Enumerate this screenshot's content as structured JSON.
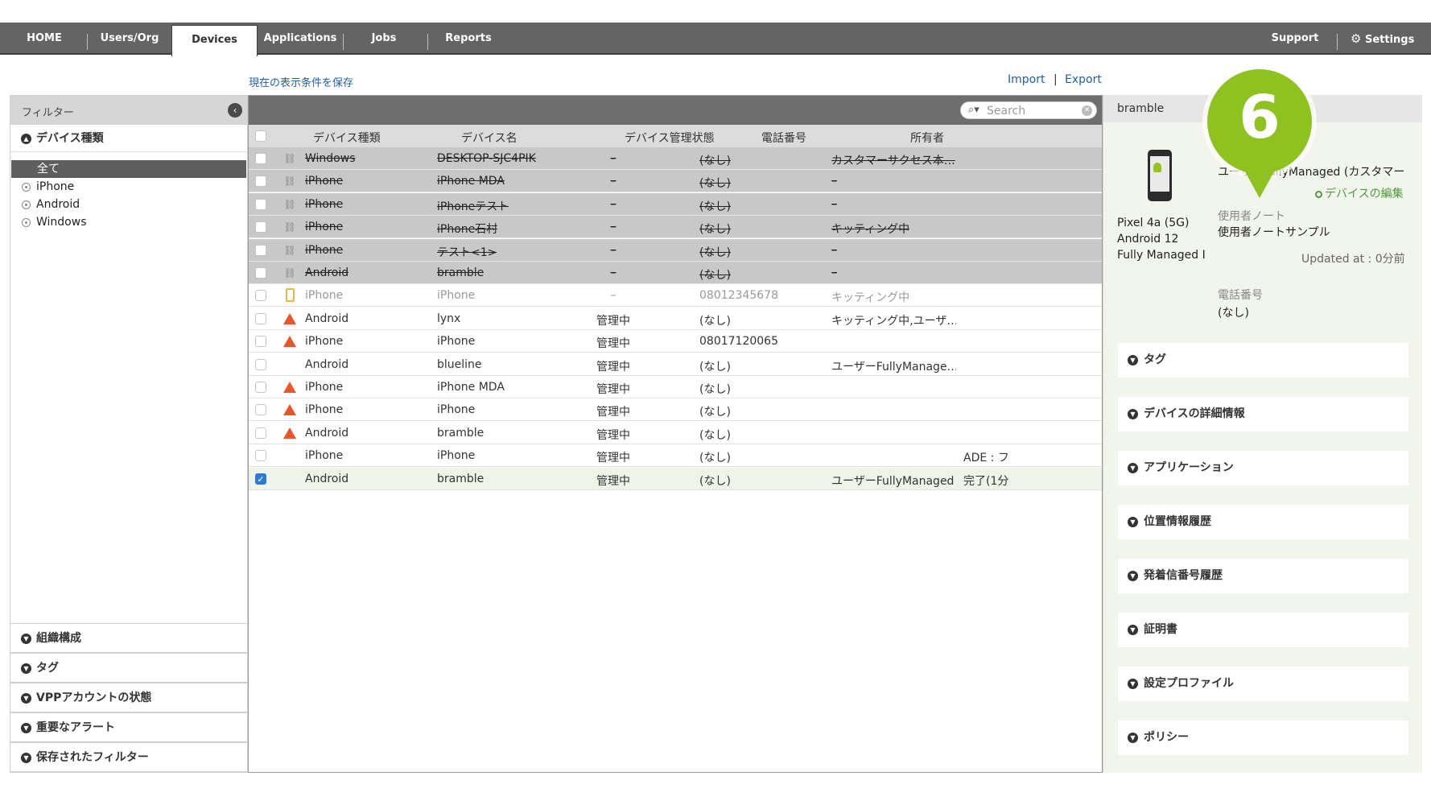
{
  "nav": {
    "items": [
      "HOME",
      "Users/Org",
      "Devices",
      "Applications",
      "Jobs",
      "Reports"
    ],
    "support": "Support",
    "settings": "Settings",
    "settings_icon": "gear-icon"
  },
  "toolbar": {
    "save_filter": "現在の表示条件を保存",
    "import": "Import",
    "separator": "|",
    "export": "Export"
  },
  "filter": {
    "title": "フィルター",
    "device_type_section": "デバイス種類",
    "types": [
      "全て",
      "iPhone",
      "Android",
      "Windows"
    ],
    "sections": [
      "組織構成",
      "タグ",
      "VPPアカウントの状態",
      "重要なアラート",
      "保存されたフィルター"
    ]
  },
  "table": {
    "search_placeholder": "Search",
    "headers": [
      "デバイス種類",
      "デバイス名",
      "デバイス管理状態",
      "電話番号",
      "所有者"
    ],
    "rows": [
      {
        "style": "retired",
        "icon": "link-icon",
        "type": "Windows",
        "name": "DESKTOP-SJC4PIK",
        "state": "–",
        "phone": "(なし)",
        "owner": "カスタマーサクセス本…",
        "extra": ""
      },
      {
        "style": "retired",
        "icon": "link-icon",
        "type": "iPhone",
        "name": "iPhone MDA",
        "state": "–",
        "phone": "(なし)",
        "owner": "–",
        "extra": ""
      },
      {
        "style": "retired",
        "icon": "link-icon",
        "type": "iPhone",
        "name": "iPhoneテスト",
        "state": "–",
        "phone": "(なし)",
        "owner": "–",
        "extra": ""
      },
      {
        "style": "retired",
        "icon": "link-icon",
        "type": "iPhone",
        "name": "iPhone石村",
        "state": "–",
        "phone": "(なし)",
        "owner": "キッティング中",
        "extra": ""
      },
      {
        "style": "retired",
        "icon": "link-icon",
        "type": "iPhone",
        "name": "テスト<1>",
        "state": "–",
        "phone": "(なし)",
        "owner": "–",
        "extra": ""
      },
      {
        "style": "retired",
        "icon": "link-icon",
        "type": "Android",
        "name": "bramble",
        "state": "–",
        "phone": "(なし)",
        "owner": "–",
        "extra": ""
      },
      {
        "style": "dim",
        "icon": "phone-icon",
        "type": "iPhone",
        "name": "iPhone",
        "state": "–",
        "phone": "08012345678",
        "owner": "キッティング中",
        "extra": ""
      },
      {
        "style": "normal",
        "icon": "warning-icon",
        "type": "Android",
        "name": "lynx",
        "state": "管理中",
        "phone": "(なし)",
        "owner": "キッティング中,ユーザ…",
        "extra": ""
      },
      {
        "style": "normal",
        "icon": "warning-icon",
        "type": "iPhone",
        "name": "iPhone",
        "state": "管理中",
        "phone": "08017120065",
        "owner": "",
        "extra": ""
      },
      {
        "style": "normal",
        "icon": "",
        "type": "Android",
        "name": "blueline",
        "state": "管理中",
        "phone": "(なし)",
        "owner": "ユーザーFullyManage…",
        "extra": ""
      },
      {
        "style": "normal",
        "icon": "warning-icon",
        "type": "iPhone",
        "name": "iPhone MDA",
        "state": "管理中",
        "phone": "(なし)",
        "owner": "",
        "extra": ""
      },
      {
        "style": "normal",
        "icon": "warning-icon",
        "type": "iPhone",
        "name": "iPhone",
        "state": "管理中",
        "phone": "(なし)",
        "owner": "",
        "extra": ""
      },
      {
        "style": "normal",
        "icon": "warning-icon",
        "type": "Android",
        "name": "bramble",
        "state": "管理中",
        "phone": "(なし)",
        "owner": "",
        "extra": ""
      },
      {
        "style": "normal",
        "icon": "",
        "type": "iPhone",
        "name": "iPhone",
        "state": "管理中",
        "phone": "(なし)",
        "owner": "",
        "extra": "ADE : フ"
      },
      {
        "style": "selected",
        "icon": "",
        "type": "Android",
        "name": "bramble",
        "state": "管理中",
        "phone": "(なし)",
        "owner": "ユーザーFullyManaged",
        "extra": "完了(1分"
      }
    ]
  },
  "detail": {
    "device_name": "bramble",
    "model": "Pixel 4a (5G)",
    "os": "Android 12",
    "mode": "Fully Managed I",
    "owner_line": "ユーザーFullyManaged (カスタマー",
    "edit": "デバイスの編集",
    "note_label": "使用者ノート",
    "note_value": "使用者ノートサンプル",
    "updated": "Updated at : 0分前",
    "phone_label": "電話番号",
    "phone_value": "(なし)",
    "sections": [
      "タグ",
      "デバイスの詳細情報",
      "アプリケーション",
      "位置情報履歴",
      "発着信番号履歴",
      "証明書",
      "設定プロファイル",
      "ポリシー"
    ]
  },
  "callout": {
    "number": "6",
    "color": "#8ec31f"
  }
}
